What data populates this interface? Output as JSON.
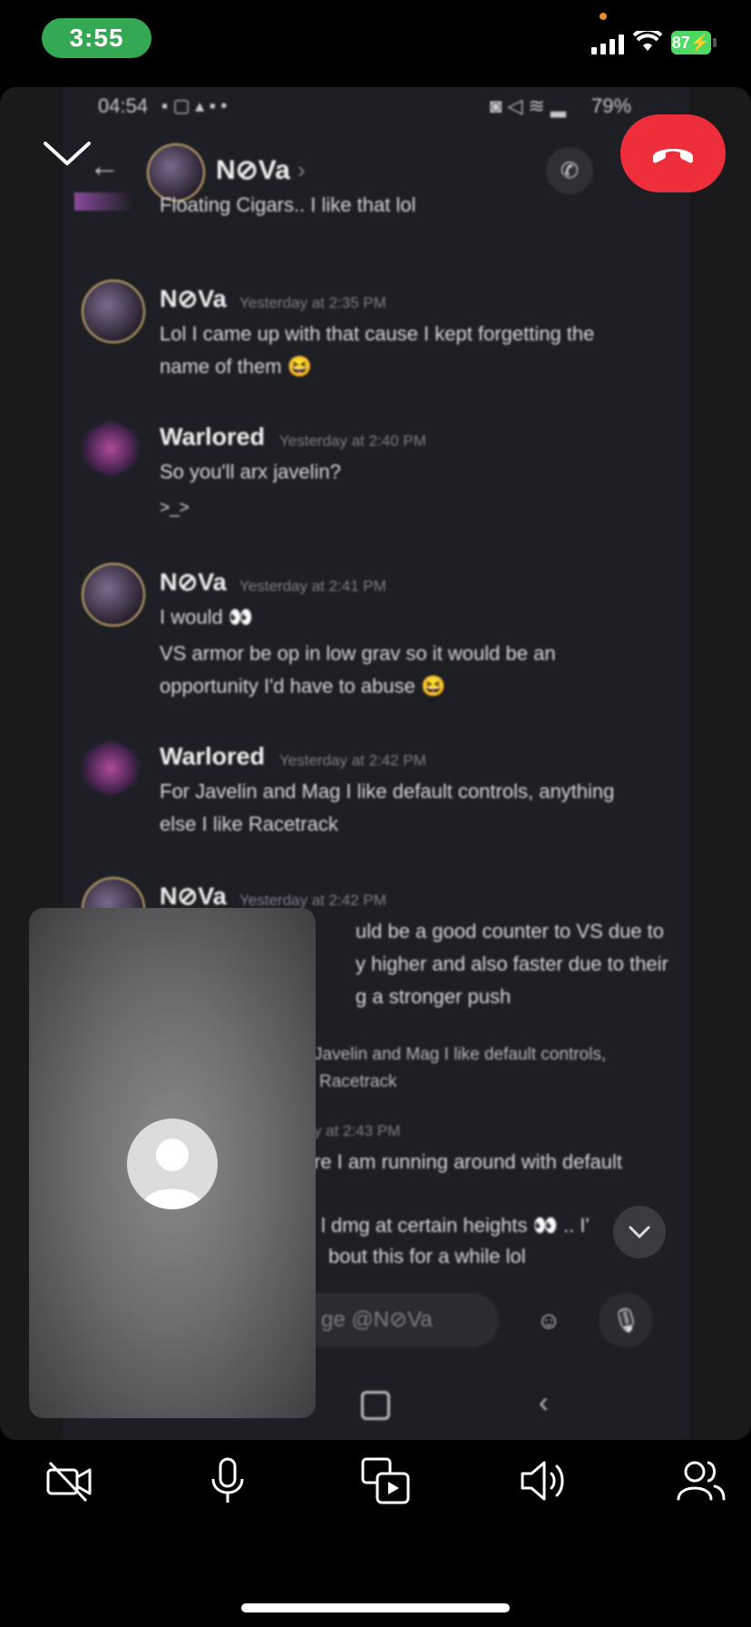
{
  "status_bar": {
    "time": "3:55",
    "battery": "87"
  },
  "shared_screen": {
    "phone_status": {
      "time": "04:54",
      "battery": "79%"
    },
    "chat_header": {
      "name": "N⊘Va",
      "chevron": "›"
    },
    "messages": [
      {
        "kind": "continuation",
        "text": "Floating Cigars.. I like that lol"
      },
      {
        "user": "N⊘Va",
        "time": "Yesterday at 2:35 PM",
        "lines": [
          "Lol I came up with that cause I kept forgetting the",
          "name of them 😆"
        ]
      },
      {
        "user": "Warlored",
        "time": "Yesterday at 2:40 PM",
        "lines": [
          "So you'll arx javelin?",
          ">_>"
        ]
      },
      {
        "user": "N⊘Va",
        "time": "Yesterday at 2:41 PM",
        "lines": [
          "I would 👀",
          "VS armor be op in low grav so it would be an",
          "opportunity I'd have to abuse 😆"
        ]
      },
      {
        "user": "Warlored",
        "time": "Yesterday at 2:42 PM",
        "lines": [
          "For Javelin and Mag I like default controls, anything",
          "else I like Racetrack"
        ]
      },
      {
        "user": "N⊘Va",
        "time": "Yesterday at 2:42 PM",
        "lines": [
          "uld be a good counter to VS due to",
          "y higher and also faster due to their",
          "g a stronger push"
        ]
      },
      {
        "kind": "reply",
        "lines": [
          "Javelin and Mag I like default controls,",
          "Racetrack"
        ]
      },
      {
        "kind": "partial",
        "time": "y at 2:43 PM",
        "lines": [
          "re I am running around with default",
          "l dmg at certain heights 👀 .. I'",
          "bout this for a while lol"
        ]
      }
    ],
    "input_placeholder": "ge @N⊘Va"
  },
  "controls": {
    "camera": "camera-off",
    "mic": "microphone",
    "share": "screen-share",
    "speaker": "speaker",
    "people": "participants"
  }
}
